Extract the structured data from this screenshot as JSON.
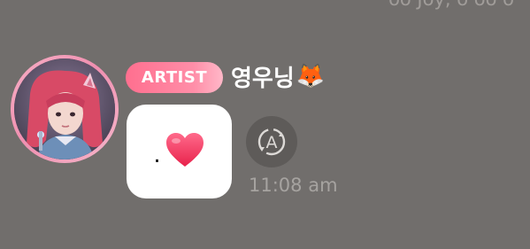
{
  "header": {
    "partial_top_text": "oo Joy, o oo o"
  },
  "message": {
    "badge_label": "ARTIST",
    "sender_name": "영우닝",
    "sender_emoji": "🦊",
    "content_dot": ".",
    "content_emoji": "❤️",
    "timestamp": "11:08 am",
    "translate_glyph": "A",
    "translate_icon": "translate-icon"
  },
  "colors": {
    "background": "#716e6c",
    "badge": "#ff7a98",
    "ring": "#f39ab8",
    "bubble": "#ffffff",
    "timestamp": "#a6a3a0",
    "translate_bg": "#5e5b59"
  }
}
